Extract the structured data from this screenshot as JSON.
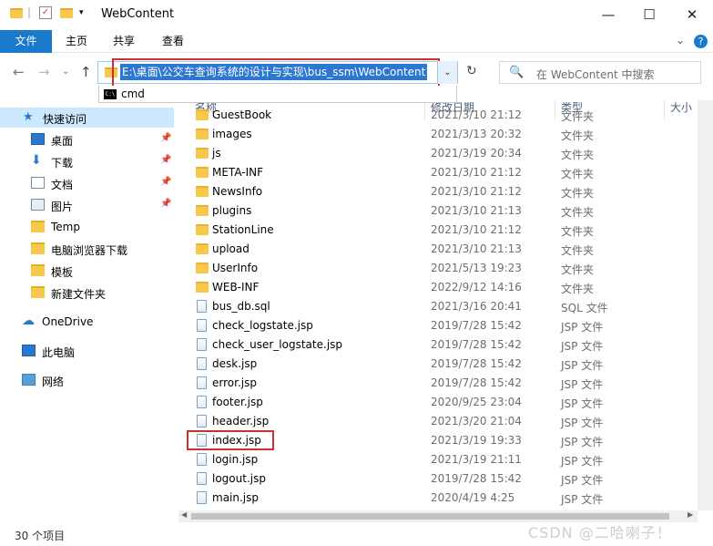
{
  "window": {
    "title": "WebContent",
    "minimize": "—",
    "maximize": "☐",
    "close": "✕"
  },
  "ribbon": {
    "tabs": [
      "文件",
      "主页",
      "共享",
      "查看"
    ],
    "expand": "⌄",
    "help": "?"
  },
  "address": {
    "back": "←",
    "forward": "→",
    "recent": "⌄",
    "up": "↑",
    "path": "E:\\桌面\\公交车查询系统的设计与实现\\bus_ssm\\WebContent",
    "dropdown": "⌄",
    "refresh": "↻",
    "suggestion": "cmd",
    "cmd_icon_text": "C:\\"
  },
  "search": {
    "placeholder": "在 WebContent 中搜索"
  },
  "sidebar": {
    "items": [
      {
        "label": "快速访问",
        "icon": "star-icon",
        "pinned": false,
        "selected": true
      },
      {
        "label": "桌面",
        "icon": "desktop-icon",
        "pinned": true
      },
      {
        "label": "下载",
        "icon": "download-icon",
        "pinned": true
      },
      {
        "label": "文档",
        "icon": "document-icon",
        "pinned": true
      },
      {
        "label": "图片",
        "icon": "picture-icon",
        "pinned": true
      },
      {
        "label": "Temp",
        "icon": "folder-icon",
        "pinned": false
      },
      {
        "label": "电脑浏览器下载",
        "icon": "folder-icon",
        "pinned": false
      },
      {
        "label": "模板",
        "icon": "folder-icon",
        "pinned": false
      },
      {
        "label": "新建文件夹",
        "icon": "folder-icon",
        "pinned": false
      },
      {
        "label": "OneDrive",
        "icon": "cloud-icon",
        "pinned": false
      },
      {
        "label": "此电脑",
        "icon": "computer-icon",
        "pinned": false
      },
      {
        "label": "网络",
        "icon": "network-icon",
        "pinned": false
      }
    ],
    "pin_glyph": "📌"
  },
  "columns": {
    "name": "名称",
    "date": "修改日期",
    "type": "类型",
    "size": "大小"
  },
  "files": [
    {
      "name": "GuestBook",
      "date": "2021/3/10 21:12",
      "type": "文件夹",
      "kind": "folder"
    },
    {
      "name": "images",
      "date": "2021/3/13 20:32",
      "type": "文件夹",
      "kind": "folder"
    },
    {
      "name": "js",
      "date": "2021/3/19 20:34",
      "type": "文件夹",
      "kind": "folder"
    },
    {
      "name": "META-INF",
      "date": "2021/3/10 21:12",
      "type": "文件夹",
      "kind": "folder"
    },
    {
      "name": "NewsInfo",
      "date": "2021/3/10 21:12",
      "type": "文件夹",
      "kind": "folder"
    },
    {
      "name": "plugins",
      "date": "2021/3/10 21:13",
      "type": "文件夹",
      "kind": "folder"
    },
    {
      "name": "StationLine",
      "date": "2021/3/10 21:12",
      "type": "文件夹",
      "kind": "folder"
    },
    {
      "name": "upload",
      "date": "2021/3/10 21:13",
      "type": "文件夹",
      "kind": "folder"
    },
    {
      "name": "UserInfo",
      "date": "2021/5/13 19:23",
      "type": "文件夹",
      "kind": "folder"
    },
    {
      "name": "WEB-INF",
      "date": "2022/9/12 14:16",
      "type": "文件夹",
      "kind": "folder"
    },
    {
      "name": "bus_db.sql",
      "date": "2021/3/16 20:41",
      "type": "SQL 文件",
      "kind": "file"
    },
    {
      "name": "check_logstate.jsp",
      "date": "2019/7/28 15:42",
      "type": "JSP 文件",
      "kind": "file"
    },
    {
      "name": "check_user_logstate.jsp",
      "date": "2019/7/28 15:42",
      "type": "JSP 文件",
      "kind": "file"
    },
    {
      "name": "desk.jsp",
      "date": "2019/7/28 15:42",
      "type": "JSP 文件",
      "kind": "file"
    },
    {
      "name": "error.jsp",
      "date": "2019/7/28 15:42",
      "type": "JSP 文件",
      "kind": "file"
    },
    {
      "name": "footer.jsp",
      "date": "2020/9/25 23:04",
      "type": "JSP 文件",
      "kind": "file"
    },
    {
      "name": "header.jsp",
      "date": "2021/3/20 21:04",
      "type": "JSP 文件",
      "kind": "file"
    },
    {
      "name": "index.jsp",
      "date": "2021/3/19 19:33",
      "type": "JSP 文件",
      "kind": "file"
    },
    {
      "name": "login.jsp",
      "date": "2021/3/19 21:11",
      "type": "JSP 文件",
      "kind": "file"
    },
    {
      "name": "logout.jsp",
      "date": "2019/7/28 15:42",
      "type": "JSP 文件",
      "kind": "file"
    },
    {
      "name": "main.jsp",
      "date": "2020/4/19 4:25",
      "type": "JSP 文件",
      "kind": "file"
    }
  ],
  "status": {
    "count": "30 个项目"
  },
  "watermark": "CSDN @二哈喇子！"
}
